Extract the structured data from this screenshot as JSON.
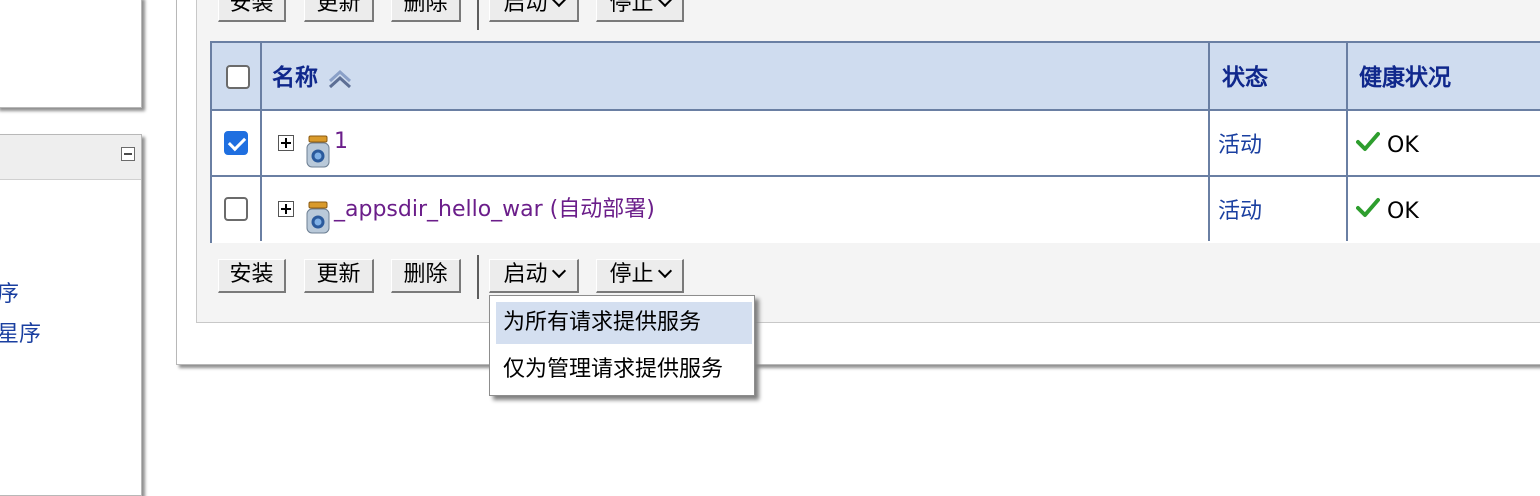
{
  "left_nav": {
    "link_1_partial": "序",
    "link_2_partial": "星序"
  },
  "toolbar": {
    "install": "安装",
    "update": "更新",
    "delete": "删除",
    "start": "启动",
    "stop": "停止"
  },
  "table": {
    "columns": [
      "名称",
      "状态",
      "健康状况"
    ],
    "rows": [
      {
        "selected": true,
        "name": "1",
        "state": "活动",
        "health": "OK"
      },
      {
        "selected": false,
        "name": "_appsdir_hello_war (自动部署)",
        "state": "活动",
        "health": "OK"
      }
    ]
  },
  "start_menu": {
    "items": [
      "为所有请求提供服务",
      "仅为管理请求提供服务"
    ],
    "highlighted_index": 0
  },
  "colors": {
    "header_bg": "#cfdcef",
    "header_text": "#10288c",
    "link": "#1a3fa0",
    "app_name": "#6b1e8a",
    "checkbox_checked": "#1f6fe0",
    "health_ok": "#2e9e2e",
    "menu_highlight": "#d4dff0"
  },
  "icons": {
    "sort": "double-chevron-up-icon",
    "expand": "plus-box-icon",
    "app": "jar-icon",
    "health": "checkmark-icon",
    "collapse": "minus-box-icon"
  }
}
